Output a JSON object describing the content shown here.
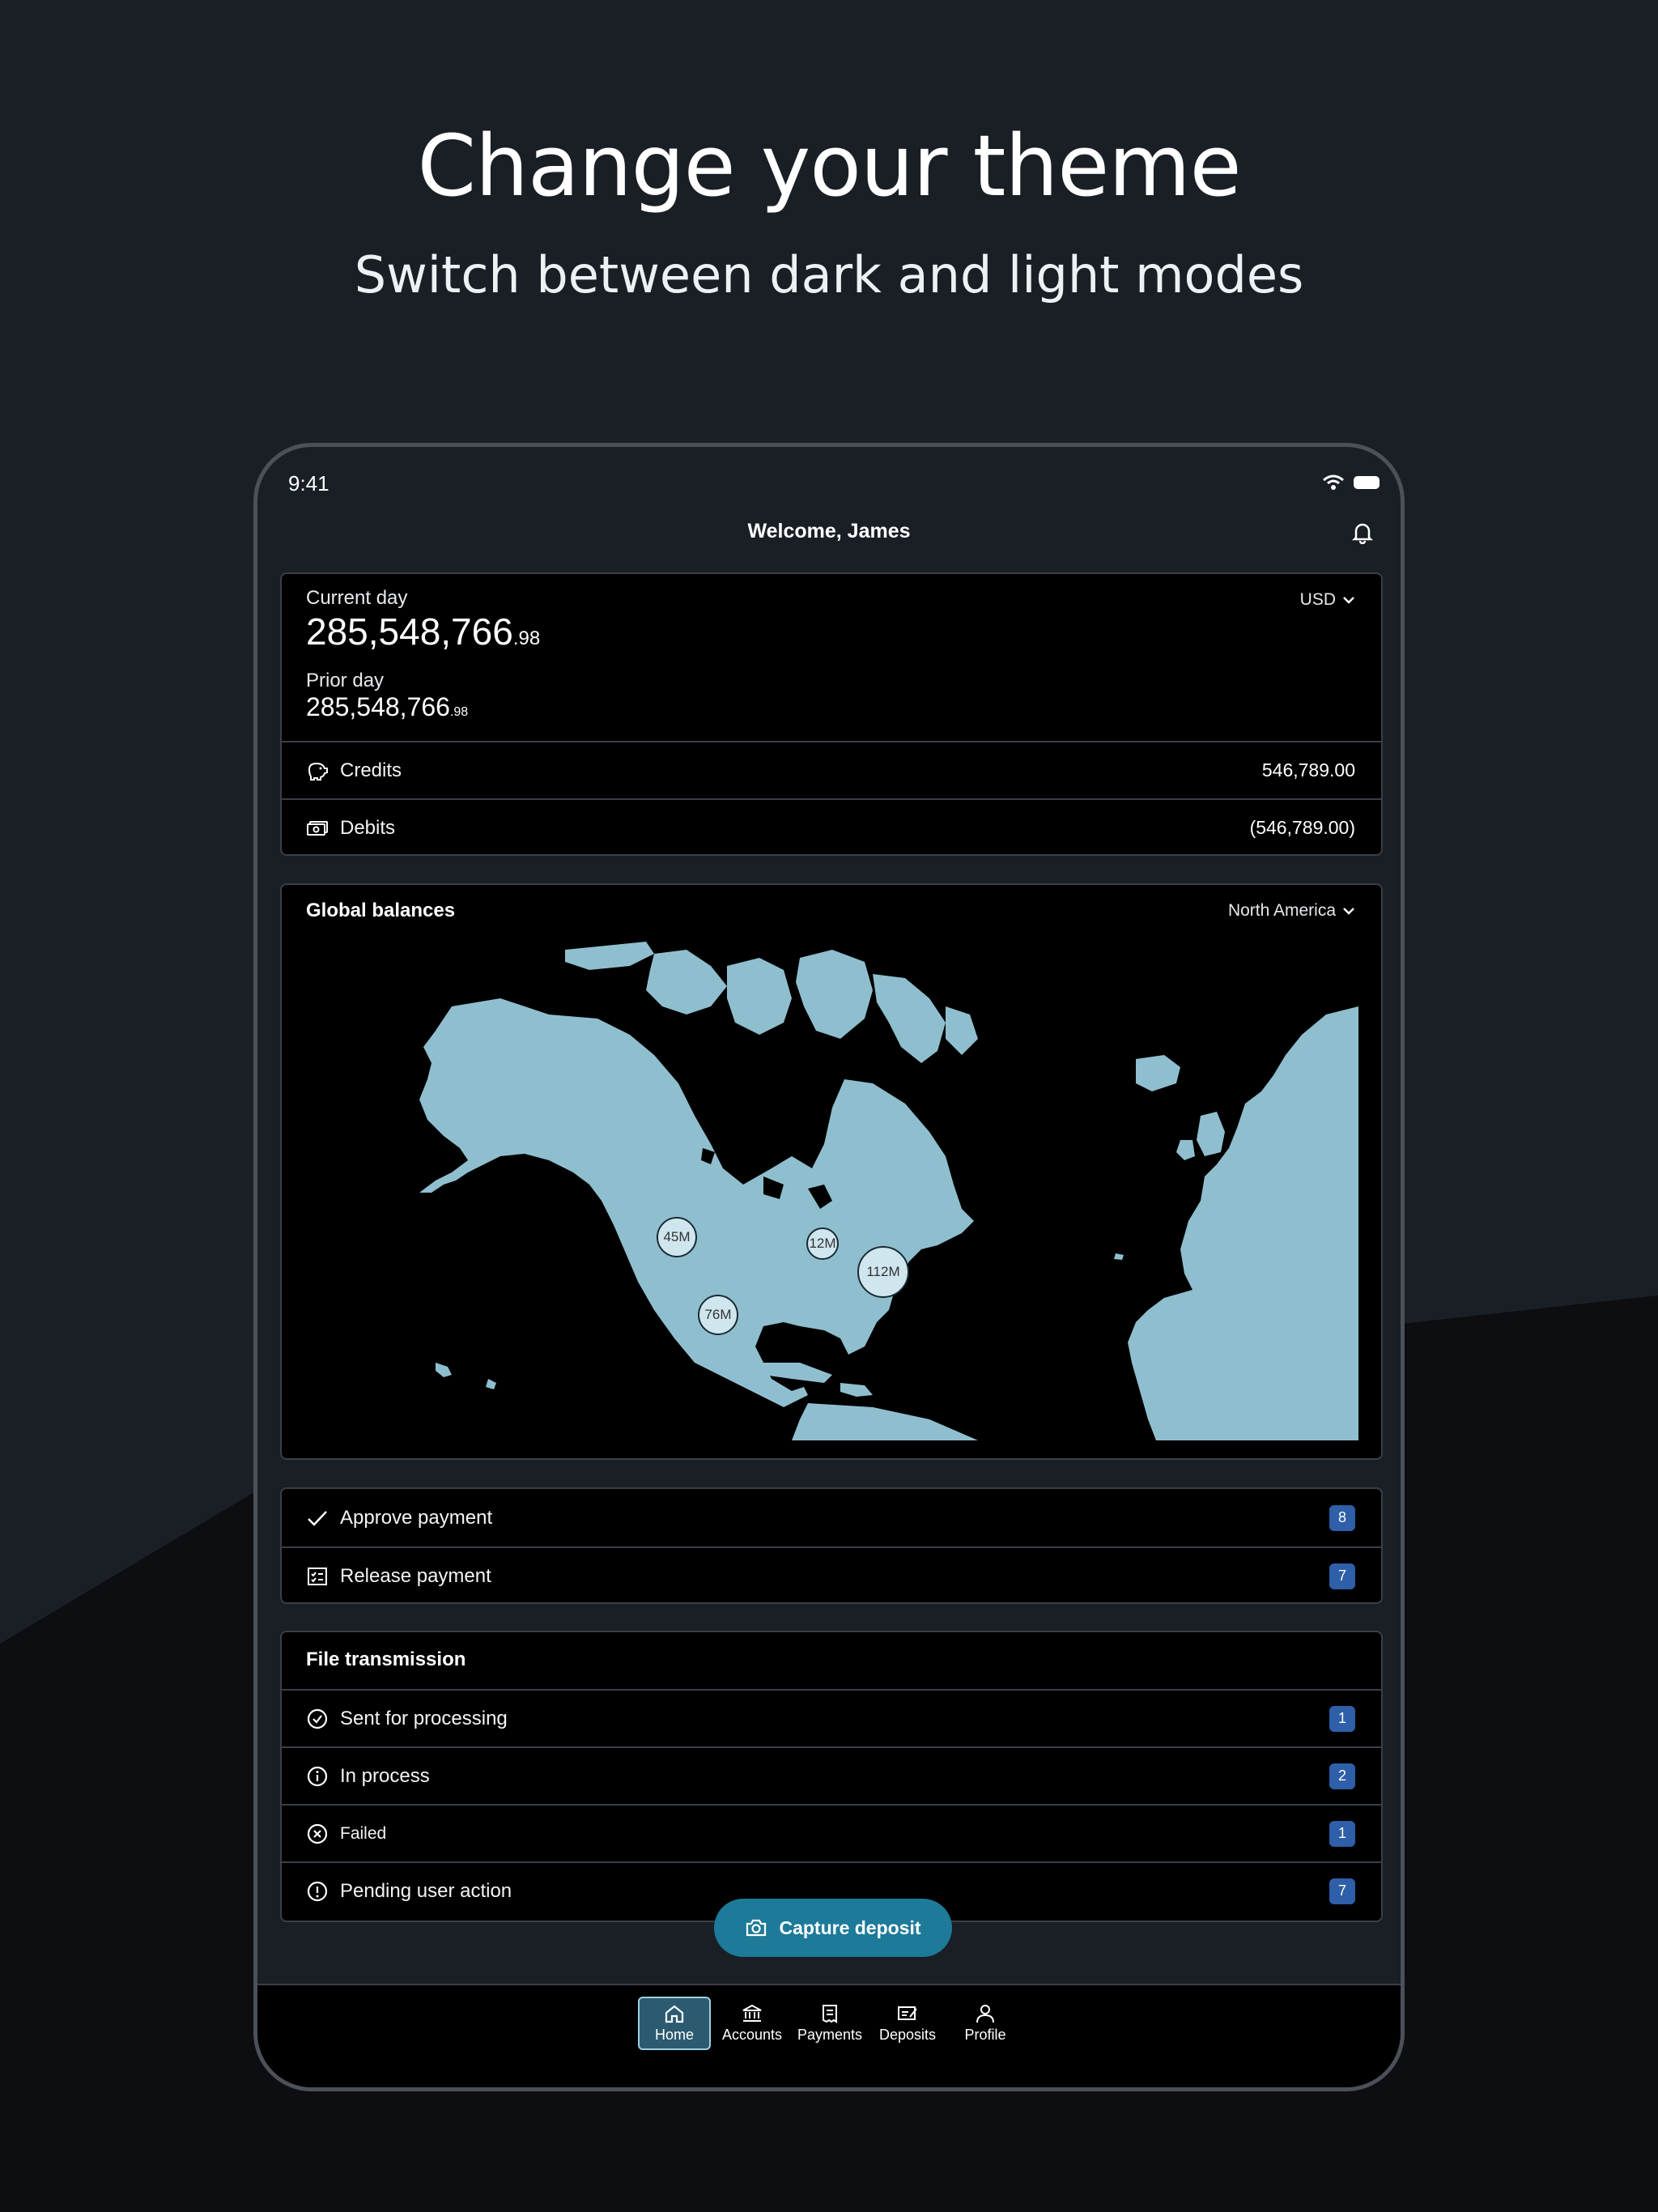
{
  "marketing": {
    "headline": "Change your theme",
    "subhead": "Switch between dark and light modes"
  },
  "status_bar": {
    "time": "9:41"
  },
  "header": {
    "title": "Welcome, James"
  },
  "balances": {
    "current_label": "Current day",
    "current_main": "285,548,766",
    "current_cents": ".98",
    "prior_label": "Prior day",
    "prior_main": "285,548,766",
    "prior_cents": ".98",
    "currency": "USD",
    "credits_label": "Credits",
    "credits_value": "546,789.00",
    "debits_label": "Debits",
    "debits_value": "(546,789.00)"
  },
  "global": {
    "title": "Global balances",
    "region": "North America",
    "markers": [
      "45M",
      "12M",
      "112M",
      "76M"
    ],
    "map_color": "#8fbfcf"
  },
  "approvals": {
    "items": [
      {
        "label": "Approve payment",
        "count": "8",
        "icon": "check-icon"
      },
      {
        "label": "Release payment",
        "count": "7",
        "icon": "checklist-icon"
      }
    ]
  },
  "files": {
    "title": "File transmission",
    "items": [
      {
        "label": "Sent for processing",
        "count": "1",
        "icon": "check-circle-icon"
      },
      {
        "label": "In process",
        "count": "2",
        "icon": "info-icon"
      },
      {
        "label": "Failed",
        "count": "1",
        "icon": "x-circle-icon"
      },
      {
        "label": "Pending user action",
        "count": "7",
        "icon": "alert-icon"
      }
    ]
  },
  "fab": {
    "label": "Capture deposit"
  },
  "tabbar": {
    "items": [
      {
        "label": "Home",
        "icon": "home-icon"
      },
      {
        "label": "Accounts",
        "icon": "bank-icon"
      },
      {
        "label": "Payments",
        "icon": "receipt-icon"
      },
      {
        "label": "Deposits",
        "icon": "check-deposit-icon"
      },
      {
        "label": "Profile",
        "icon": "person-icon"
      }
    ]
  },
  "colors": {
    "accent": "#1d7a99",
    "badge": "#2e5fa8",
    "background": "#1a1f26"
  }
}
